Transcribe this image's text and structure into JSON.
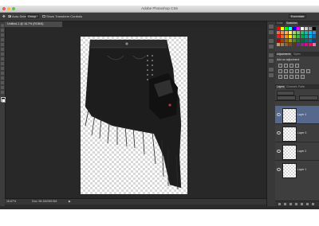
{
  "app": {
    "title": "Adobe Photoshop CS6"
  },
  "options_bar": {
    "auto_select_label": "Auto-Select:",
    "auto_select_value": "Group",
    "show_transform_label": "Show Transform Controls",
    "workspace": "Essentials"
  },
  "document": {
    "tab_label": "Untitled-1 @ 16.7% (RGB/8)",
    "status_zoom": "16.67%",
    "status_doc": "Doc: 98.1M/289.5M"
  },
  "panels": {
    "color_tabs": [
      "Color",
      "Swatches"
    ],
    "adjustments_tabs": [
      "Adjustments",
      "Styles"
    ],
    "adjustments_heading": "Add an adjustment",
    "layers_tabs": [
      "Layers",
      "Channels",
      "Paths"
    ],
    "layers": [
      {
        "name": "Layer 4",
        "selected": true
      },
      {
        "name": "Layer 3",
        "selected": false
      },
      {
        "name": "Layer 2",
        "selected": false
      },
      {
        "name": "Layer 1",
        "selected": false
      }
    ]
  },
  "colors": {
    "selection": "#56698c",
    "panel_bg": "#3e3e3e",
    "canvas_bg": "#282828"
  }
}
